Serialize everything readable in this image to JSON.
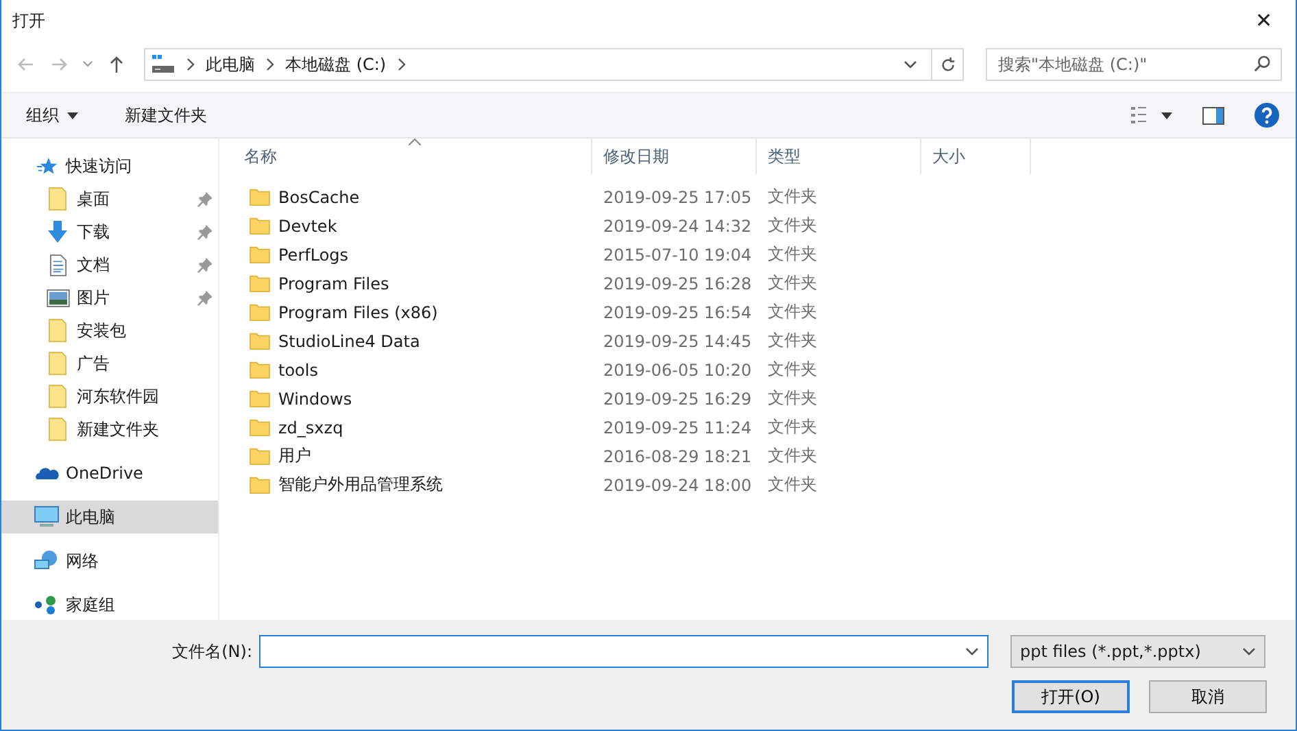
{
  "window": {
    "title": "打开",
    "close": "✕"
  },
  "address": {
    "path": [
      {
        "label": "此电脑"
      },
      {
        "label": "本地磁盘 (C:)"
      }
    ]
  },
  "search": {
    "placeholder": "搜索\"本地磁盘 (C:)\""
  },
  "toolbar": {
    "organize": "组织",
    "new_folder": "新建文件夹"
  },
  "sidebar": {
    "items": [
      {
        "label": "快速访问",
        "kind": "star",
        "pinned": false,
        "selected": false,
        "children": [
          {
            "label": "桌面",
            "kind": "folder",
            "pinned": true,
            "selected": false
          },
          {
            "label": "下载",
            "kind": "download",
            "pinned": true,
            "selected": false
          },
          {
            "label": "文档",
            "kind": "document",
            "pinned": true,
            "selected": false
          },
          {
            "label": "图片",
            "kind": "pictures",
            "pinned": true,
            "selected": false
          },
          {
            "label": "安装包",
            "kind": "folder",
            "pinned": false,
            "selected": false
          },
          {
            "label": "广告",
            "kind": "folder",
            "pinned": false,
            "selected": false
          },
          {
            "label": "河东软件园",
            "kind": "folder",
            "pinned": false,
            "selected": false
          },
          {
            "label": "新建文件夹",
            "kind": "folder",
            "pinned": false,
            "selected": false
          }
        ]
      },
      {
        "label": "OneDrive",
        "kind": "cloud",
        "pinned": false,
        "selected": false
      },
      {
        "label": "此电脑",
        "kind": "computer",
        "pinned": false,
        "selected": true
      },
      {
        "label": "网络",
        "kind": "network",
        "pinned": false,
        "selected": false
      },
      {
        "label": "家庭组",
        "kind": "homegroup",
        "pinned": false,
        "selected": false
      }
    ]
  },
  "table": {
    "columns": [
      {
        "label": "名称",
        "sorted": true
      },
      {
        "label": "修改日期",
        "sorted": false
      },
      {
        "label": "类型",
        "sorted": false
      },
      {
        "label": "大小",
        "sorted": false
      }
    ],
    "rows": [
      {
        "name": "BosCache",
        "date": "2019-09-25 17:05",
        "type": "文件夹"
      },
      {
        "name": "Devtek",
        "date": "2019-09-24 14:32",
        "type": "文件夹"
      },
      {
        "name": "PerfLogs",
        "date": "2015-07-10 19:04",
        "type": "文件夹"
      },
      {
        "name": "Program Files",
        "date": "2019-09-25 16:28",
        "type": "文件夹"
      },
      {
        "name": "Program Files (x86)",
        "date": "2019-09-25 16:54",
        "type": "文件夹"
      },
      {
        "name": "StudioLine4 Data",
        "date": "2019-09-25 14:45",
        "type": "文件夹"
      },
      {
        "name": "tools",
        "date": "2019-06-05 10:20",
        "type": "文件夹"
      },
      {
        "name": "Windows",
        "date": "2019-09-25 16:29",
        "type": "文件夹"
      },
      {
        "name": "zd_sxzq",
        "date": "2019-09-25 11:24",
        "type": "文件夹"
      },
      {
        "name": "用户",
        "date": "2016-08-29 18:21",
        "type": "文件夹"
      },
      {
        "name": "智能户外用品管理系统",
        "date": "2019-09-24 18:00",
        "type": "文件夹"
      }
    ]
  },
  "footer": {
    "filename_label": "文件名(N):",
    "filter": "ppt files (*.ppt,*.pptx)",
    "open": "打开(O)",
    "cancel": "取消"
  }
}
